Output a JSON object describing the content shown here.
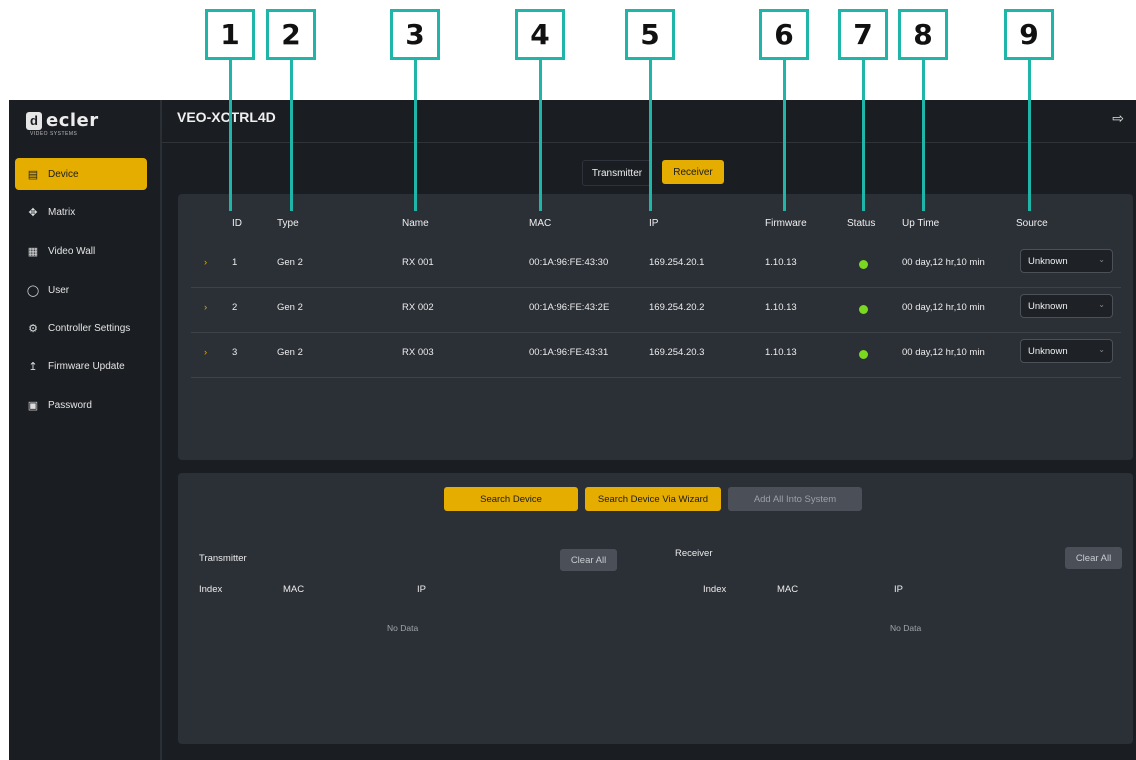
{
  "callouts": [
    "1",
    "2",
    "3",
    "4",
    "5",
    "6",
    "7",
    "8",
    "9"
  ],
  "sidebar": {
    "logo_text": "ecler",
    "logo_sub": "VIDEO SYSTEMS",
    "items": [
      {
        "label": "Device",
        "icon": "device-icon",
        "active": true
      },
      {
        "label": "Matrix",
        "icon": "matrix-icon"
      },
      {
        "label": "Video Wall",
        "icon": "video-wall-icon"
      },
      {
        "label": "User",
        "icon": "user-icon"
      },
      {
        "label": "Controller Settings",
        "icon": "gear-icon"
      },
      {
        "label": "Firmware Update",
        "icon": "upload-icon"
      },
      {
        "label": "Password",
        "icon": "lock-icon"
      }
    ]
  },
  "header": {
    "title": "VEO-XCTRL4D",
    "logout_icon": "logout-icon"
  },
  "tabs": {
    "transmitter": "Transmitter",
    "receiver": "Receiver",
    "selected": "Receiver"
  },
  "table": {
    "headers": [
      "ID",
      "Type",
      "Name",
      "MAC",
      "IP",
      "Firmware",
      "Status",
      "Up Time",
      "Source"
    ],
    "rows": [
      {
        "id": "1",
        "type": "Gen 2",
        "name": "RX 001",
        "mac": "00:1A:96:FE:43:30",
        "ip": "169.254.20.1",
        "firmware": "1.10.13",
        "status": "online",
        "uptime": "00 day,12 hr,10 min",
        "source": "Unknown"
      },
      {
        "id": "2",
        "type": "Gen 2",
        "name": "RX 002",
        "mac": "00:1A:96:FE:43:2E",
        "ip": "169.254.20.2",
        "firmware": "1.10.13",
        "status": "online",
        "uptime": "00 day,12 hr,10 min",
        "source": "Unknown"
      },
      {
        "id": "3",
        "type": "Gen 2",
        "name": "RX 003",
        "mac": "00:1A:96:FE:43:31",
        "ip": "169.254.20.3",
        "firmware": "1.10.13",
        "status": "online",
        "uptime": "00 day,12 hr,10 min",
        "source": "Unknown"
      }
    ]
  },
  "search": {
    "search_device": "Search Device",
    "search_wizard": "Search Device Via Wizard",
    "add_all": "Add All Into System",
    "transmitter": {
      "title": "Transmitter",
      "clear": "Clear All",
      "cols": [
        "Index",
        "MAC",
        "IP"
      ],
      "empty": "No Data"
    },
    "receiver": {
      "title": "Receiver",
      "clear": "Clear All",
      "cols": [
        "Index",
        "MAC",
        "IP"
      ],
      "empty": "No Data"
    }
  },
  "colors": {
    "accent": "#e5ad00",
    "callout": "#1fb5a8",
    "status_online": "#7bd821",
    "background": "#1a1d22",
    "panel": "#2b2f36"
  }
}
